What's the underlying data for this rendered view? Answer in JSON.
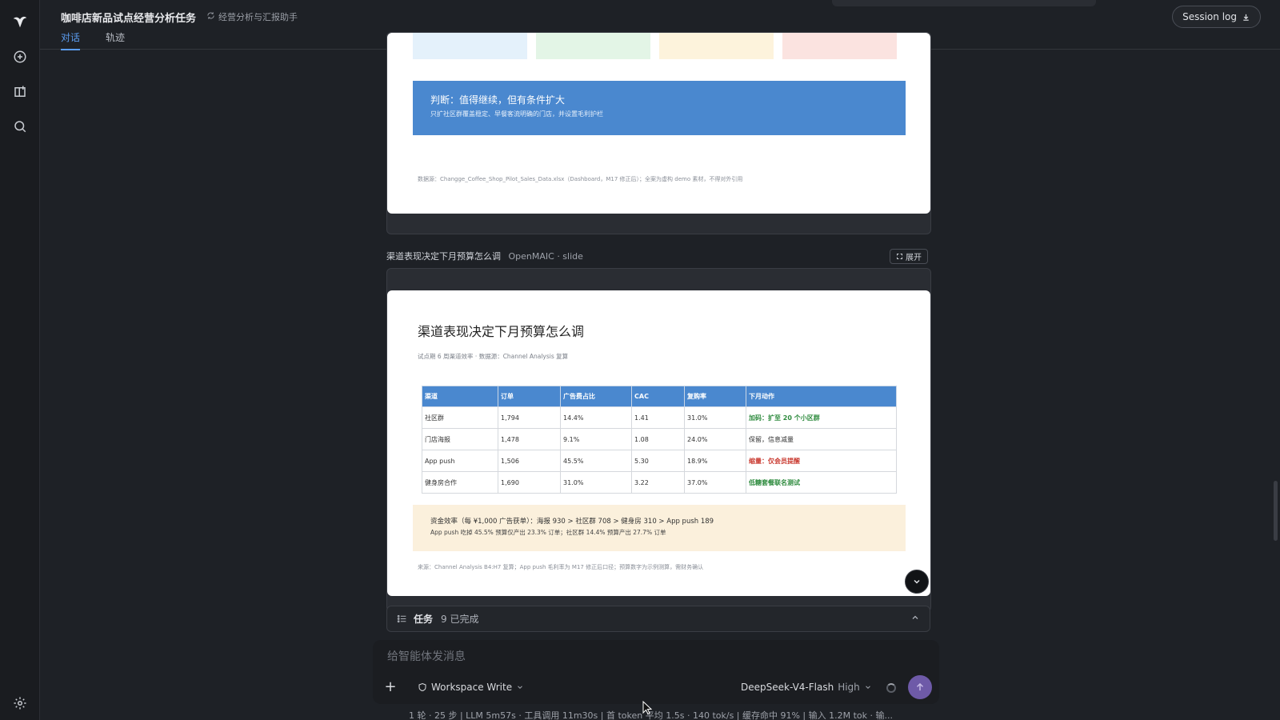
{
  "header": {
    "title": "咖啡店新品试点经营分析任务",
    "agent_label": "经营分析与汇报助手",
    "tabs": [
      {
        "label": "对话",
        "active": true
      },
      {
        "label": "轨迹",
        "active": false
      }
    ],
    "session_button": "Session log"
  },
  "rail": {
    "icons": [
      "app-logo-icon",
      "new-chat-icon",
      "new-folder-icon",
      "search-icon",
      "settings-icon"
    ]
  },
  "slide1": {
    "verdict_title": "判断：值得继续，但有条件扩大",
    "verdict_sub": "只扩社区群覆盖稳定、早餐客流明确的门店，并设置毛利护栏",
    "source": "数据源：Changge_Coffee_Shop_Pilot_Sales_Data.xlsx（Dashboard，M17 修正后）；全案为虚构 demo 素材，不得对外引用",
    "kpi_colors": [
      "#e4f1fb",
      "#e3f5e6",
      "#fdf3dc",
      "#fbe3e0"
    ]
  },
  "slide2_caption": {
    "title": "渠道表现决定下月预算怎么调",
    "meta": "OpenMAIC · slide",
    "expand_label": "展开"
  },
  "slide2": {
    "title": "渠道表现决定下月预算怎么调",
    "subtitle": "试点期 6 周渠道效率 · 数据源：Channel Analysis 复算",
    "table": {
      "headers": [
        "渠道",
        "订单",
        "广告费占比",
        "CAC",
        "复购率",
        "下月动作"
      ],
      "rows": [
        {
          "channel": "社区群",
          "orders": "1,794",
          "ad_share": "14.4%",
          "cac": "1.41",
          "repurchase": "31.0%",
          "action": "加码：扩至 20 个小区群",
          "action_style": "green"
        },
        {
          "channel": "门店海报",
          "orders": "1,478",
          "ad_share": "9.1%",
          "cac": "1.08",
          "repurchase": "24.0%",
          "action": "保留，信息减量",
          "action_style": "normal"
        },
        {
          "channel": "App push",
          "orders": "1,506",
          "ad_share": "45.5%",
          "cac": "5.30",
          "repurchase": "18.9%",
          "action": "缩量：仅会员提醒",
          "action_style": "red"
        },
        {
          "channel": "健身房合作",
          "orders": "1,690",
          "ad_share": "31.0%",
          "cac": "3.22",
          "repurchase": "37.0%",
          "action": "低糖套餐联名测试",
          "action_style": "green"
        }
      ]
    },
    "note_line1": "资金效率（每 ¥1,000 广告获单）：海报 930 > 社区群 708 > 健身房 310 > App push 189",
    "note_line2": "App push 吃掉 45.5% 预算仅产出 23.3% 订单；社区群 14.4% 预算产出 27.7% 订单",
    "source": "来源：Channel Analysis B4:H7 复算；App push 毛利率为 M17 修正后口径；预算数字为示例测算，需财务确认"
  },
  "tasks": {
    "label": "任务",
    "count": "9 已完成"
  },
  "composer": {
    "placeholder": "给智能体发消息",
    "mode": "Workspace Write",
    "model": "DeepSeek-V4-Flash",
    "level": "High"
  },
  "status_bar": "1 轮 · 25 步  |  LLM 5m57s · 工具调用 11m30s  |  首 token 平均 1.5s · 140 tok/s  |  缓存命中 91%  |  输入 1.2M tok · 输..."
}
